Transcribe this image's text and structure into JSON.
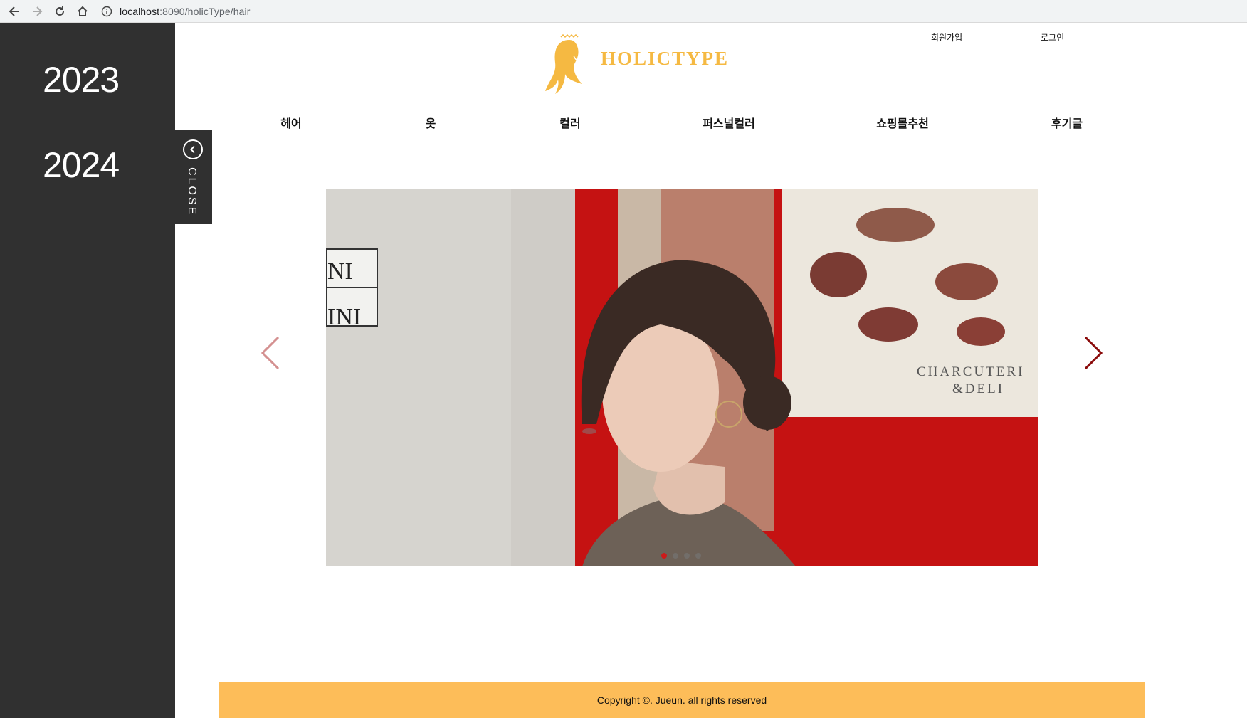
{
  "browser": {
    "url_host": "localhost",
    "url_path": ":8090/holicType/hair"
  },
  "sidebar": {
    "years": [
      "2023",
      "2024"
    ],
    "close_label": "CLOSE"
  },
  "header": {
    "logo_text": "HOLICTYPE",
    "signup_label": "회원가입",
    "login_label": "로그인"
  },
  "nav": {
    "items": [
      {
        "label": "헤어"
      },
      {
        "label": "옷"
      },
      {
        "label": "컬러"
      },
      {
        "label": "퍼스널컬러"
      },
      {
        "label": "쇼핑몰추천"
      },
      {
        "label": "후기글"
      }
    ]
  },
  "slider": {
    "slide_count": 4,
    "active_index": 0,
    "poster_text_line1": "CHARCUTERI",
    "poster_text_line2": "&DELI",
    "sign_text": "INI"
  },
  "footer": {
    "copyright": "Copyright ©. Jueun. all rights reserved"
  },
  "colors": {
    "sidebar_bg": "#303030",
    "brand_gold": "#f5b942",
    "footer_bg": "#fdbd59",
    "arrow_next": "#8b0c0c",
    "arrow_prev": "#d49090",
    "dot_active": "#cc1a1a"
  }
}
